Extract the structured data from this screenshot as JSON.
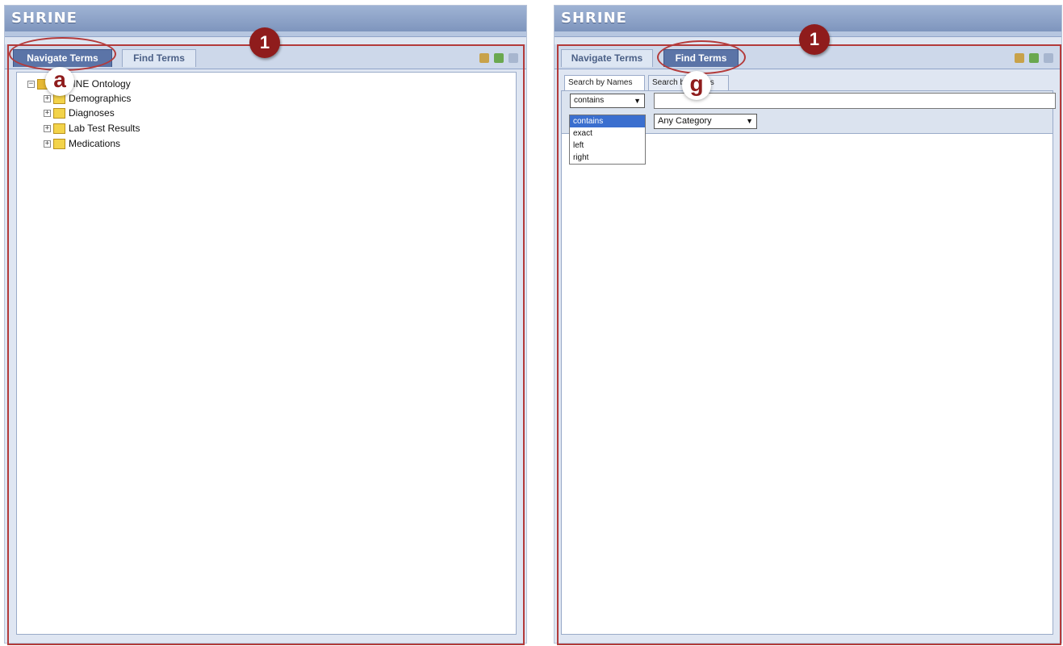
{
  "app_title": "SHRINE",
  "step_badge": "1",
  "left": {
    "tabs": [
      "Navigate Terms",
      "Find Terms"
    ],
    "active_tab": "Navigate Terms",
    "callout": "a",
    "tree": {
      "root": "SHRINE Ontology",
      "children": [
        "Demographics",
        "Diagnoses",
        "Lab Test Results",
        "Medications"
      ]
    }
  },
  "right": {
    "tabs": [
      "Navigate Terms",
      "Find Terms"
    ],
    "active_tab": "Find Terms",
    "callout": "g",
    "subtabs": [
      "Search by Names",
      "Search by Codes"
    ],
    "match_select": {
      "value": "contains",
      "options": [
        "contains",
        "exact",
        "left",
        "right"
      ]
    },
    "search_text": "",
    "category_select": {
      "value": "Any Category"
    }
  },
  "colors": {
    "annotation": "#b33a3a",
    "badge": "#8f1c1c",
    "header": "#7e95bd",
    "active_tab": "#5b74a7"
  }
}
